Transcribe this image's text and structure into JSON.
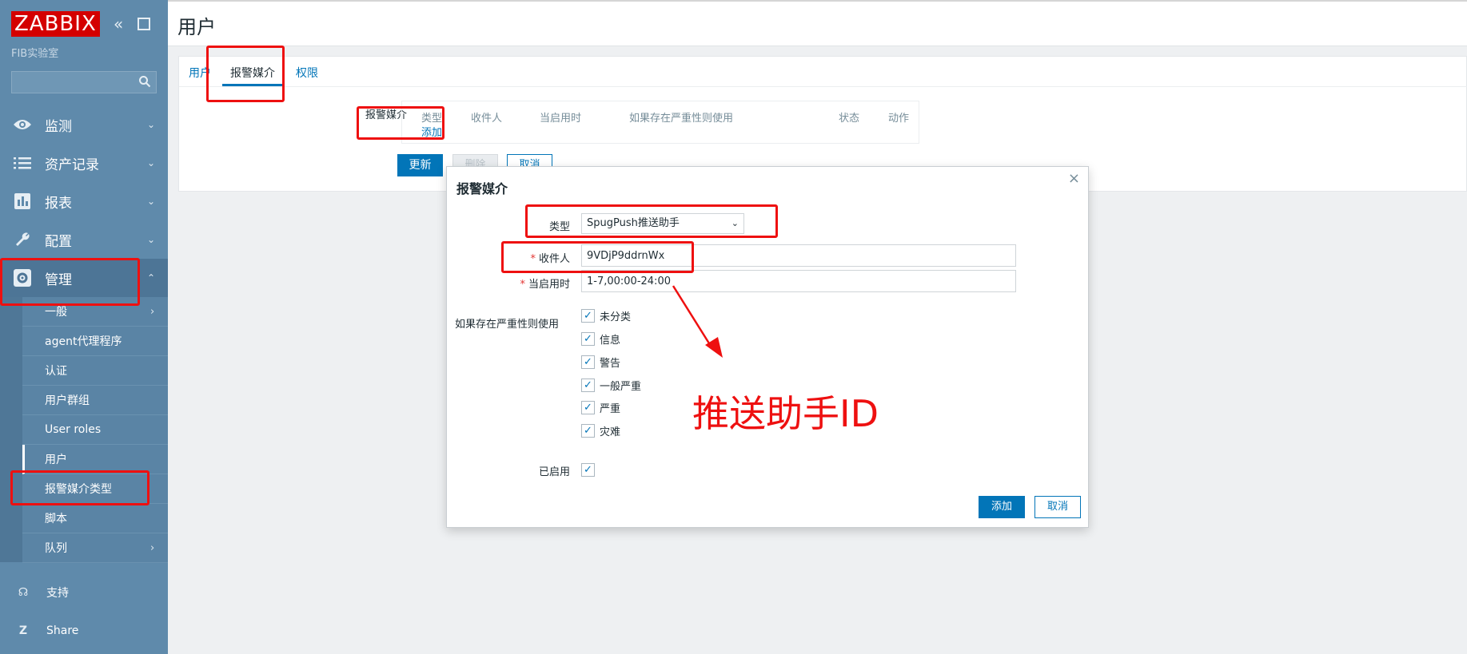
{
  "sidebar": {
    "logo": "ZABBIX",
    "subtitle": "FIB实验室",
    "search_placeholder": "",
    "menu": [
      {
        "label": "监测",
        "icon": "eye-icon"
      },
      {
        "label": "资产记录",
        "icon": "list-icon"
      },
      {
        "label": "报表",
        "icon": "bar-chart-icon"
      },
      {
        "label": "配置",
        "icon": "wrench-icon"
      },
      {
        "label": "管理",
        "icon": "gear-icon"
      }
    ],
    "submenu": [
      {
        "label": "一般"
      },
      {
        "label": "agent代理程序"
      },
      {
        "label": "认证"
      },
      {
        "label": "用户群组"
      },
      {
        "label": "User roles"
      },
      {
        "label": "用户"
      },
      {
        "label": "报警媒介类型"
      },
      {
        "label": "脚本"
      },
      {
        "label": "队列"
      }
    ],
    "bottom": [
      {
        "label": "支持",
        "icon": "headset-icon"
      },
      {
        "label": "Share",
        "icon": "share-icon"
      }
    ]
  },
  "header": {
    "title": "用户"
  },
  "tabs": [
    {
      "label": "用户"
    },
    {
      "label": "报警媒介"
    },
    {
      "label": "权限"
    }
  ],
  "media": {
    "label": "报警媒介",
    "columns": [
      "类型",
      "收件人",
      "当启用时",
      "如果存在严重性则使用",
      "状态",
      "动作"
    ],
    "add_link": "添加"
  },
  "form_buttons": {
    "update": "更新",
    "delete": "删除",
    "cancel": "取消"
  },
  "dialog": {
    "title": "报警媒介",
    "close": "×",
    "type_label": "类型",
    "type_value": "SpugPush推送助手",
    "recipient_label": "收件人",
    "recipient_value": "9VDjP9ddrnWx",
    "when_label": "当启用时",
    "when_value": "1-7,00:00-24:00",
    "severity_label": "如果存在严重性则使用",
    "severities": [
      "未分类",
      "信息",
      "警告",
      "一般严重",
      "严重",
      "灾难"
    ],
    "enabled_label": "已启用",
    "add": "添加",
    "cancel": "取消"
  },
  "annotation": {
    "text": "推送助手ID",
    "color": "#ee1010"
  },
  "colors": {
    "sidebar": "#5f8aab",
    "accent": "#0275b8",
    "logo_bg": "#d40000"
  }
}
